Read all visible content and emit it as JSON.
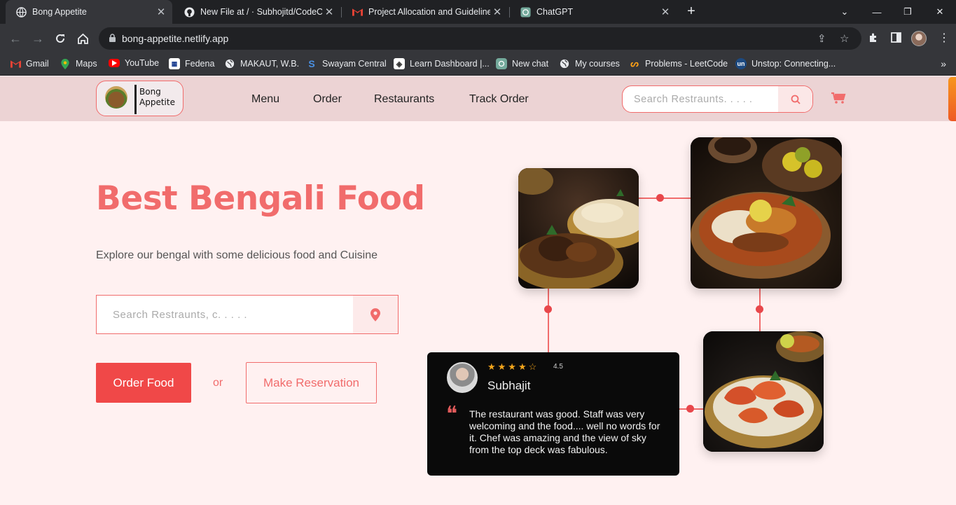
{
  "browser": {
    "tabs": [
      {
        "title": "Bong Appetite",
        "active": true,
        "icon": "globe-icon"
      },
      {
        "title": "New File at / · Subhojitd/CodeCla",
        "active": false,
        "icon": "github-icon"
      },
      {
        "title": "Project Allocation and Guidelines",
        "active": false,
        "icon": "gmail-icon"
      },
      {
        "title": "ChatGPT",
        "active": false,
        "icon": "chatgpt-icon"
      }
    ],
    "url": "bong-appetite.netlify.app",
    "bookmarks": [
      {
        "label": "Gmail",
        "icon": "gmail-icon"
      },
      {
        "label": "Maps",
        "icon": "maps-pin-icon"
      },
      {
        "label": "YouTube",
        "icon": "youtube-icon"
      },
      {
        "label": "Fedena",
        "icon": "fedena-icon"
      },
      {
        "label": "MAKAUT, W.B.",
        "icon": "globe-icon"
      },
      {
        "label": "Swayam Central",
        "icon": "swayam-icon"
      },
      {
        "label": "Learn Dashboard |...",
        "icon": "learn-icon"
      },
      {
        "label": "New chat",
        "icon": "chatgpt-icon"
      },
      {
        "label": "My courses",
        "icon": "globe-icon"
      },
      {
        "label": "Problems - LeetCode",
        "icon": "leetcode-icon"
      },
      {
        "label": "Unstop: Connecting...",
        "icon": "unstop-icon"
      }
    ]
  },
  "site": {
    "logo": {
      "line1": "Bong",
      "line2": "Appetite"
    },
    "nav": [
      "Menu",
      "Order",
      "Restaurants",
      "Track Order"
    ],
    "header_search_placeholder": "Search Restraunts. . . . .",
    "hero": {
      "title": "Best Bengali Food",
      "subtitle": "Explore our bengal with some delicious food and Cuisine",
      "search_placeholder": "Search Restraunts, c. . . . .",
      "order_button": "Order Food",
      "or_text": "or",
      "reservation_button": "Make Reservation"
    },
    "review": {
      "stars": "★★★★☆",
      "rating": "4.5",
      "name": "Subhajit",
      "quote_mark": "❝",
      "text": "The restaurant was good. Staff was very welcoming and the food.... well no words for it. Chef was amazing and the view of sky from the top deck was fabulous."
    },
    "colors": {
      "accent": "#f16c6c",
      "button": "#f04848",
      "header_bg": "#ecd3d4",
      "page_bg": "#fff1f1"
    }
  }
}
